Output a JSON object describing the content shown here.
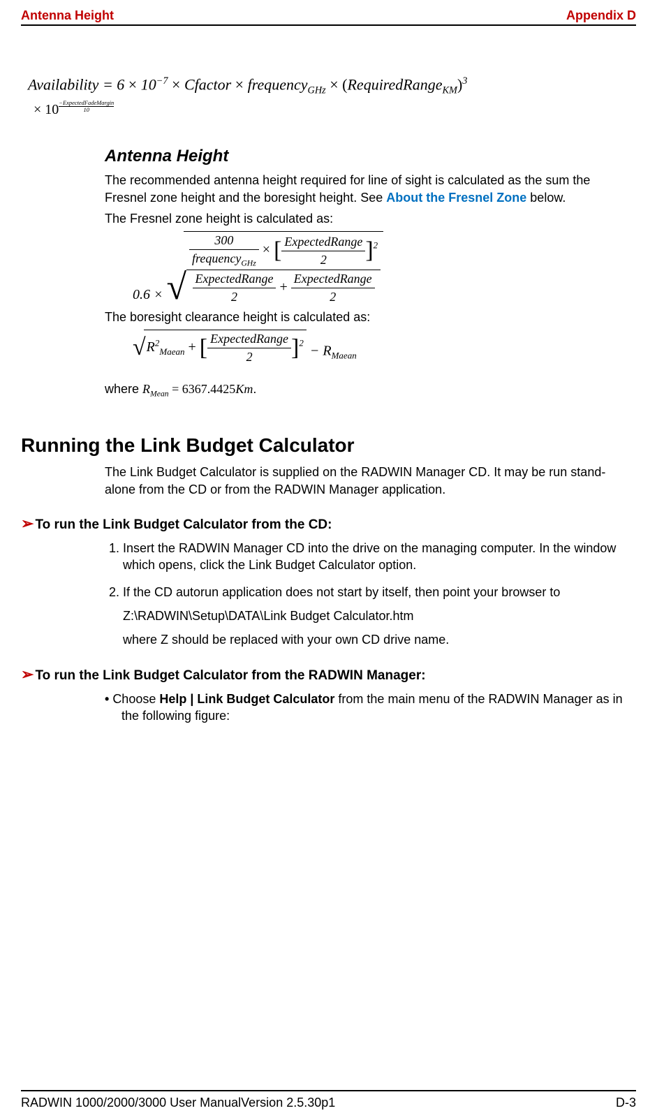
{
  "header": {
    "left": "Antenna Height",
    "right": "Appendix D"
  },
  "formula_availability": {
    "lhs": "Availability",
    "eq": " = ",
    "coef": "6",
    "times": "×",
    "ten": "10",
    "exp_neg7": "−7",
    "cfactor": "Cfactor",
    "freq": "frequency",
    "freq_sub": "GHz",
    "reqrange_open": "(",
    "reqrange": "RequiredRange",
    "reqrange_sub": "KM",
    "reqrange_close": ")",
    "cube": "3",
    "line2_prefix": "× 10",
    "line2_exp_num": "−ExpectedFadeMargin",
    "line2_exp_den": "10"
  },
  "sections": {
    "antenna_height": {
      "title": "Antenna Height",
      "intro_before_link": "The recommended antenna height required for line of sight is calculated as the sum the Fresnel zone height and the boresight height. See ",
      "link_text": "About the Fresnel Zone",
      "intro_after_link": " below.",
      "fresnel_intro": "The Fresnel zone height is calculated as:",
      "fresnel_formula": {
        "coef": "0.6 ×",
        "num_300": "300",
        "freq": "frequency",
        "freq_sub": "GHz",
        "exprange": "ExpectedRange",
        "two": "2",
        "sq": "2"
      },
      "boresight_intro": "The boresight clearance height is calculated as:",
      "boresight_formula": {
        "R": "R",
        "two": "2",
        "maean": "Maean",
        "plus": "+",
        "exprange": "ExpectedRange",
        "half": "2",
        "sq": "2",
        "minus": "− R",
        "maean2": "Maean"
      },
      "where_prefix": "where ",
      "where_R": "R",
      "where_sub": "Mean",
      "where_eq": " = 6367.4425",
      "where_unit": "Km",
      "where_period": "."
    },
    "running": {
      "title": "Running the Link Budget Calculator",
      "intro": "The Link Budget Calculator is supplied on the RADWIN Manager CD. It may be run stand-alone from the CD or from the RADWIN Manager application.",
      "proc1_title": "To run the Link Budget Calculator from the CD:",
      "steps": [
        "Insert the RADWIN Manager CD into the drive on the managing computer. In the window which opens, click the Link Budget Calculator option.",
        "If the CD autorun application does not start by itself, then point your browser to"
      ],
      "step2_path": "Z:\\RADWIN\\Setup\\DATA\\Link Budget Calculator.htm",
      "step2_note": "where Z should be replaced with your own CD drive name.",
      "proc2_title": "To run the Link Budget Calculator from the RADWIN Manager:",
      "bullet_prefix": "Choose ",
      "bullet_bold": "Help | Link Budget Calculator",
      "bullet_suffix": " from the main menu of the RADWIN Manager as in the following figure:"
    }
  },
  "footer": {
    "left": "RADWIN 1000/2000/3000 User ManualVersion  2.5.30p1",
    "right": "D-3"
  }
}
